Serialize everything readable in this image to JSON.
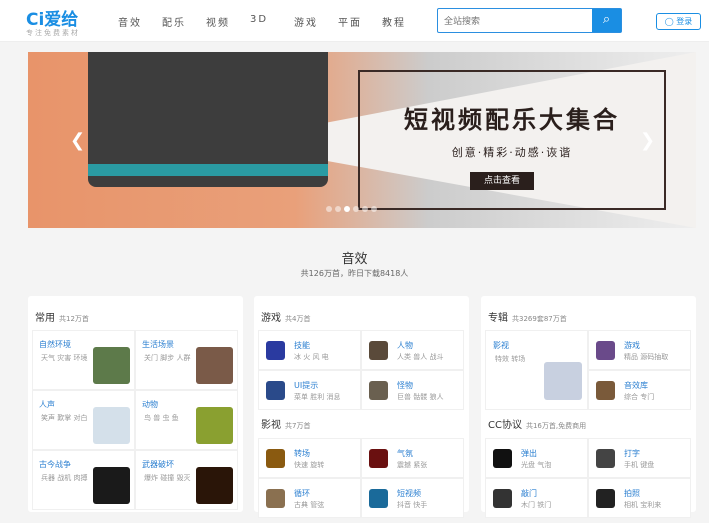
{
  "header": {
    "logo": "Ci爱给",
    "slogan": "专注免费素材",
    "nav": [
      "音效",
      "配乐",
      "视频",
      "3D",
      "游戏",
      "平面",
      "教程"
    ],
    "search_placeholder": "全站搜索",
    "login": "登录"
  },
  "banner": {
    "title": "短视频配乐大集合",
    "subtitle": "创意·精彩·动感·诙谐",
    "button": "点击查看",
    "slide_count": 6,
    "active_slide": 3
  },
  "section": {
    "title": "音效",
    "subtitle": "共126万首，昨日下载8418人"
  },
  "cards": [
    {
      "groups": [
        {
          "title": "常用",
          "count": "共12万首",
          "layout": "text-left",
          "items": [
            {
              "t": "自然环境",
              "s": "天气 灾害 环境",
              "c": "#5d7a4a"
            },
            {
              "t": "生活场景",
              "s": "关门 脚步 人群",
              "c": "#7a5a48"
            },
            {
              "t": "人声",
              "s": "笑声 歎掌 对白",
              "c": "#d4e0ea"
            },
            {
              "t": "动物",
              "s": "鸟 兽 虫 鱼",
              "c": "#8aa030"
            },
            {
              "t": "古今战争",
              "s": "兵器 战机 肉搏",
              "c": "#1a1a1a"
            },
            {
              "t": "武器破坏",
              "s": "爆炸 碰撞 毁灭",
              "c": "#2a1508"
            }
          ]
        }
      ]
    },
    {
      "groups": [
        {
          "title": "游戏",
          "count": "共4万首",
          "layout": "icon-left",
          "items": [
            {
              "t": "技能",
              "s": "冰 火 风 电",
              "c": "#2a3aa0"
            },
            {
              "t": "人物",
              "s": "人类 兽人 战斗",
              "c": "#5a4a3a"
            },
            {
              "t": "UI提示",
              "s": "菜单 胜利 消息",
              "c": "#2a4a8a"
            },
            {
              "t": "怪物",
              "s": "巨兽 骷髅 狼人",
              "c": "#6a6050"
            }
          ]
        },
        {
          "title": "影视",
          "count": "共7万首",
          "layout": "icon-left",
          "items": [
            {
              "t": "转场",
              "s": "快速 旋转",
              "c": "#8a5a10"
            },
            {
              "t": "气氛",
              "s": "震撼 紧张",
              "c": "#6a1010"
            },
            {
              "t": "循环",
              "s": "古典 管弦",
              "c": "#8a7050"
            },
            {
              "t": "短视频",
              "s": "抖音 快手",
              "c": "#1a6a9a"
            }
          ]
        }
      ]
    },
    {
      "groups": [
        {
          "title": "专辑",
          "count": "共3269套87万首",
          "layout": "album",
          "items": [
            {
              "t": "影视",
              "s": "特效 转场",
              "c": "#c8d0e0"
            },
            {
              "t": "游戏",
              "s": "精品 源码抽取",
              "c": "#6a4a8a"
            },
            {
              "t": "音效库",
              "s": "综合 专门",
              "c": "#7a5a3a"
            }
          ]
        },
        {
          "title": "CC协议",
          "count": "共16万首,免费商用",
          "layout": "icon-left",
          "items": [
            {
              "t": "弹出",
              "s": "光盘 气泡",
              "c": "#111"
            },
            {
              "t": "打字",
              "s": "手机 键盘",
              "c": "#444"
            },
            {
              "t": "敲门",
              "s": "木门 铁门",
              "c": "#333"
            },
            {
              "t": "拍照",
              "s": "相机 宝利来",
              "c": "#222"
            }
          ]
        }
      ]
    }
  ]
}
